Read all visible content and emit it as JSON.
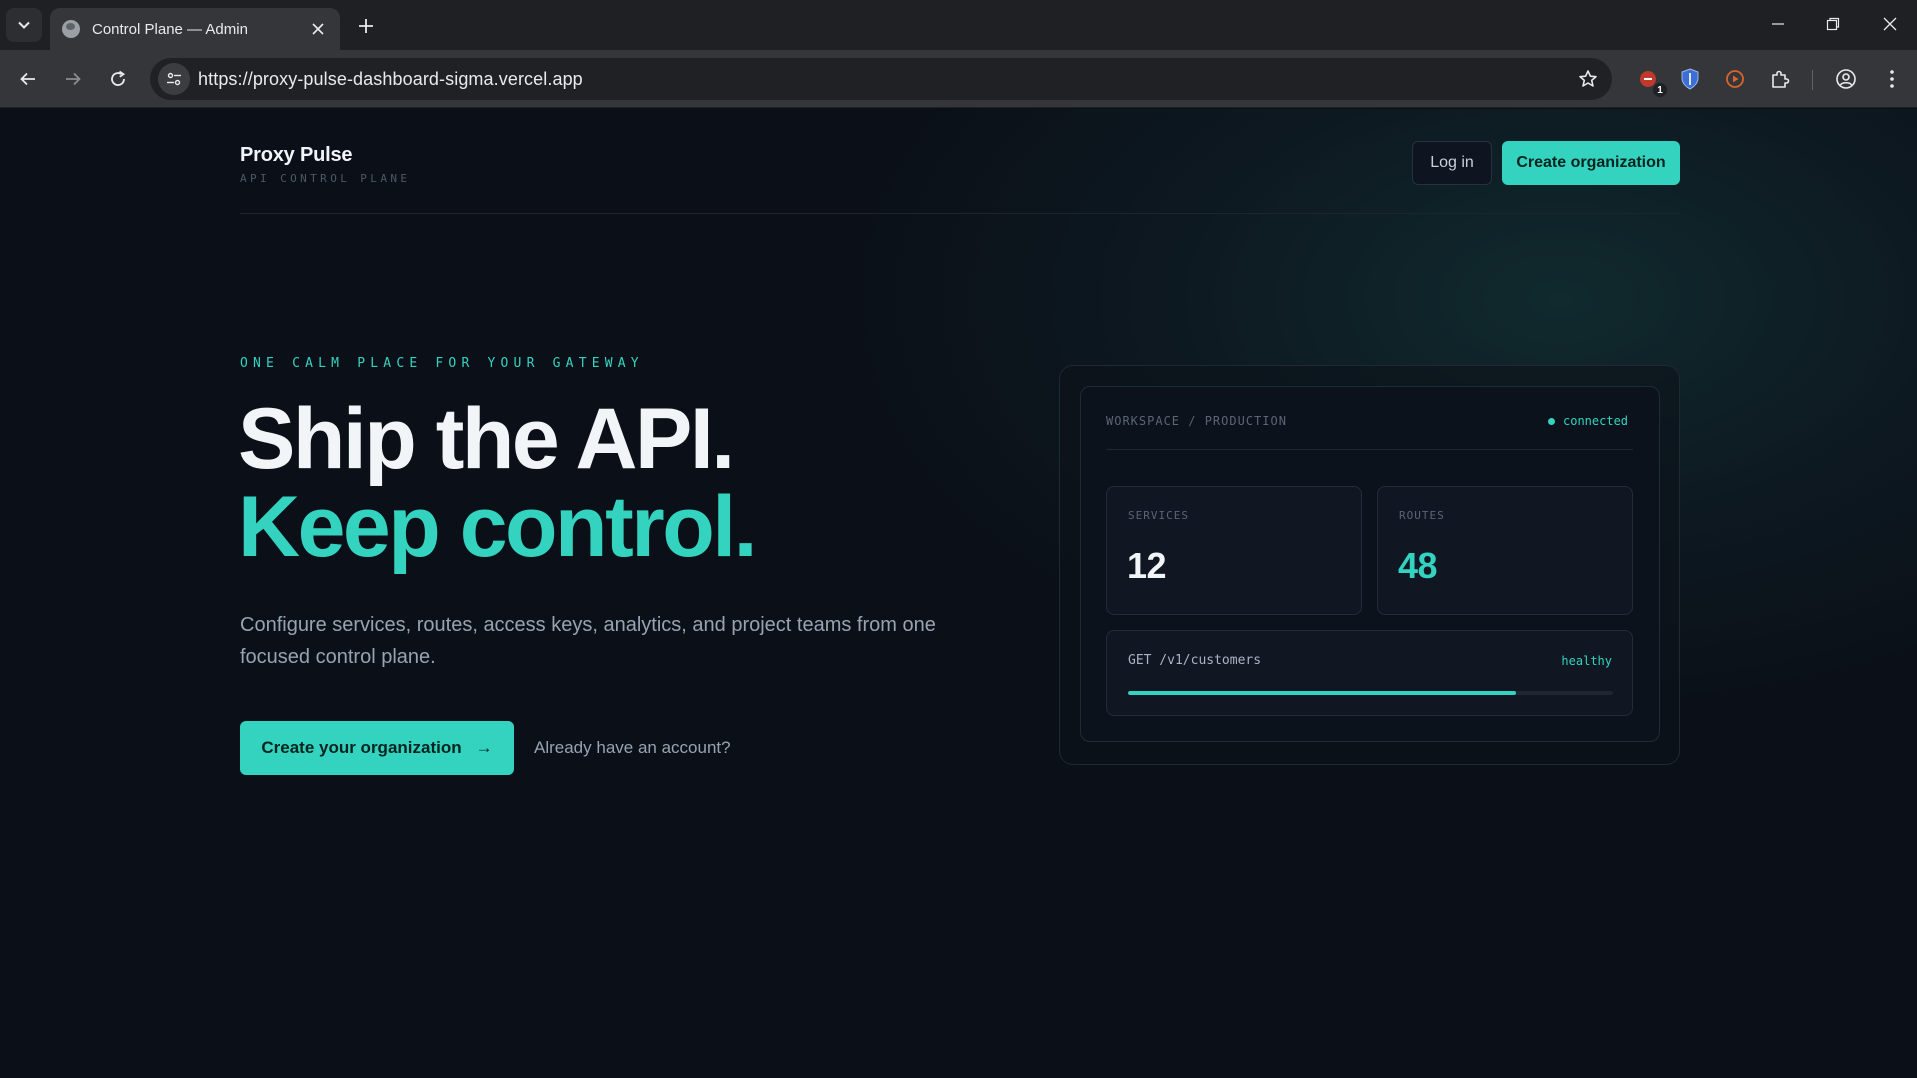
{
  "browser": {
    "tab_title": "Control Plane — Admin",
    "url": "https://proxy-pulse-dashboard-sigma.vercel.app",
    "extension_badge": "1"
  },
  "header": {
    "brand_name": "Proxy Pulse",
    "brand_sub": "API CONTROL PLANE",
    "login_label": "Log in",
    "create_org_label": "Create organization"
  },
  "hero": {
    "eyebrow": "ONE CALM PLACE FOR YOUR GATEWAY",
    "headline_line1": "Ship the API.",
    "headline_line2": "Keep control.",
    "lede": "Configure services, routes, access keys, analytics, and project teams from one focused control plane.",
    "cta_label": "Create your organization",
    "cta_arrow": "→",
    "account_link": "Already have an account?"
  },
  "dashboard": {
    "workspace_label": "WORKSPACE / PRODUCTION",
    "status_label": "connected",
    "stats": [
      {
        "label": "SERVICES",
        "value": "12",
        "color": "#f2f5f8"
      },
      {
        "label": "ROUTES",
        "value": "48",
        "color": "#34d3bf"
      }
    ],
    "route": {
      "path": "GET /v1/customers",
      "health": "healthy",
      "progress": 0.8
    }
  },
  "colors": {
    "accent": "#34d3bf",
    "background": "#0b1018"
  }
}
